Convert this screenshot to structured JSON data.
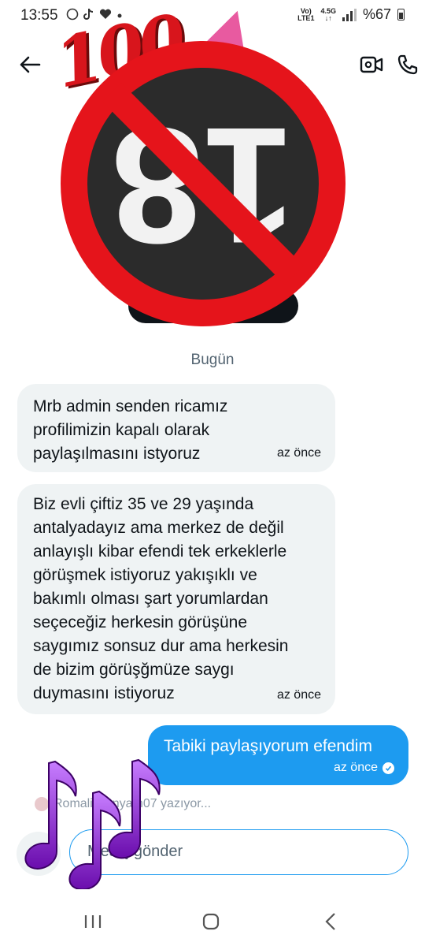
{
  "status_bar": {
    "time": "13:55",
    "notification_icons": [
      "chat-bubble-icon",
      "tiktok-icon",
      "heart-icon",
      "dot-icon"
    ],
    "network_label_top": "Vo)",
    "network_label_bottom": "LTE1",
    "network_type": "4.5G",
    "battery": "%67"
  },
  "header": {
    "back_icon": "arrow-left-icon",
    "video_call_icon": "video-camera-icon",
    "voice_call_icon": "phone-icon"
  },
  "overlay": {
    "sticker_text": "100",
    "banned_sign_text": "18",
    "colors": {
      "prohibit_red": "#e5141b",
      "sign_dark": "#2b2b2b"
    }
  },
  "chat": {
    "date_separator": "Bugün",
    "messages": [
      {
        "direction": "incoming",
        "lines": [
          "Mrb admin senden ricamız",
          "profilimizin kapalı olarak",
          "paylaşılmasını istyoruz"
        ],
        "time": "az önce"
      },
      {
        "direction": "incoming",
        "lines": [
          "Biz evli çiftiz 35 ve 29 yaşında",
          "antalyadayız ama merkez de değil",
          "anlayışlı kibar efendi tek erkeklerle",
          "görüşmek istiyoruz yakışıklı ve",
          "bakımlı olması şart yorumlardan",
          "seçeceğiz herkesin görüşüne",
          "saygımız sonsuz dur ama herkesin",
          "de bizim görüşğmüze saygı",
          "duymasını istiyoruz"
        ],
        "time": "az önce"
      },
      {
        "direction": "outgoing",
        "lines": [
          "Tabiki paylaşıyorum efendim"
        ],
        "time": "az önce",
        "status_icon": "check-circle-icon"
      }
    ],
    "typing_indicator": "Romali Dünyam07 yazıyor..."
  },
  "composer": {
    "add_icon": "plus-icon",
    "placeholder": "Mesaj gönder"
  },
  "nav_bar": {
    "recents_icon": "recents-icon",
    "home_icon": "home-icon",
    "back_icon": "nav-back-icon"
  },
  "colors": {
    "accent": "#1d9bf0",
    "incoming_bubble": "#eff3f4",
    "secondary_text": "#536471"
  }
}
